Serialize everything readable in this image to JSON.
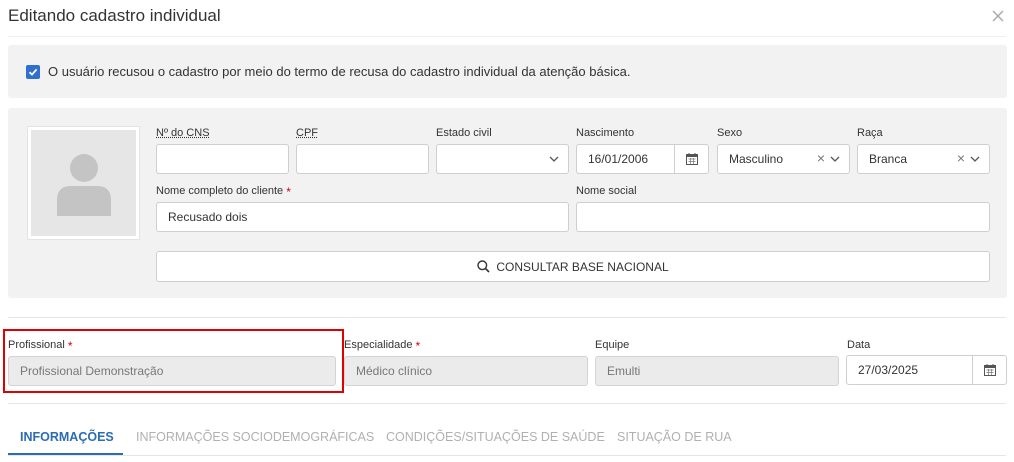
{
  "dialog": {
    "title": "Editando cadastro individual"
  },
  "refusal": {
    "checked": true,
    "text": "O usuário recusou o cadastro por meio do termo de recusa do cadastro individual da atenção básica."
  },
  "form": {
    "cns": {
      "label": "Nº do CNS",
      "value": ""
    },
    "cpf": {
      "label": "CPF",
      "value": ""
    },
    "estado_civil": {
      "label": "Estado civil",
      "value": ""
    },
    "nascimento": {
      "label": "Nascimento",
      "value": "16/01/2006"
    },
    "sexo": {
      "label": "Sexo",
      "value": "Masculino"
    },
    "raca": {
      "label": "Raça",
      "value": "Branca"
    },
    "nome": {
      "label": "Nome completo do cliente",
      "value": "Recusado dois"
    },
    "nome_social": {
      "label": "Nome social",
      "value": ""
    },
    "consult_button": "CONSULTAR BASE NACIONAL"
  },
  "professional": {
    "profissional": {
      "label": "Profissional",
      "value": "Profissional Demonstração"
    },
    "especialidade": {
      "label": "Especialidade",
      "value": "Médico clínico"
    },
    "equipe": {
      "label": "Equipe",
      "value": "Emulti"
    },
    "data": {
      "label": "Data",
      "value": "27/03/2025"
    }
  },
  "tabs": [
    {
      "label": "INFORMAÇÕES",
      "active": true
    },
    {
      "label": "INFORMAÇÕES SOCIODEMOGRÁFICAS",
      "active": false
    },
    {
      "label": "CONDIÇÕES/SITUAÇÕES DE SAÚDE",
      "active": false
    },
    {
      "label": "SITUAÇÃO DE RUA",
      "active": false
    }
  ],
  "colors": {
    "accent": "#2a6db5",
    "checkbox": "#2f6fd0",
    "highlight": "#e00000",
    "required": "#d0021b"
  },
  "icons": {
    "close": "close-icon",
    "calendar": "calendar-icon",
    "search": "search-icon",
    "chevron": "chevron-down-icon",
    "avatar": "user-placeholder-icon"
  }
}
